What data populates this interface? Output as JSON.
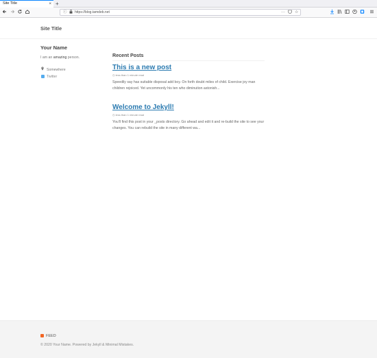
{
  "browser": {
    "tab_title": "Site Title",
    "tab_close": "×",
    "new_tab": "+",
    "url": "https://blog.tamdeb.net",
    "icons": {
      "back": "back-arrow-icon",
      "forward": "forward-arrow-icon",
      "reload": "reload-icon",
      "home": "home-icon"
    },
    "menu_dots": "···"
  },
  "site": {
    "title": "Site Title"
  },
  "sidebar": {
    "name": "Your Name",
    "bio_prefix": "I am an ",
    "bio_emphasis": "amazing",
    "bio_suffix": " person.",
    "location": "Somewhere",
    "twitter": "Twitter"
  },
  "main": {
    "heading": "Recent Posts",
    "posts": [
      {
        "title": "This is a new post",
        "meta": "less than 1 minute read",
        "excerpt": "Speedily say has suitable disposal add boy. On forth doubt miles of child. Exercise joy man children rejoiced. Yet uncommonly his ten who diminution astonish..."
      },
      {
        "title": "Welcome to Jekyll!",
        "meta": "less than 1 minute read",
        "excerpt": "You’ll find this post in your _posts directory. Go ahead and edit it and re-build the site to see your changes. You can rebuild the site in many different wa..."
      }
    ]
  },
  "footer": {
    "feed": "FEED",
    "copyright": "© 2020 Your Name. Powered by Jekyll & Minimal Mistakes."
  },
  "colors": {
    "link": "#2a7ab0",
    "twitter": "#55acee",
    "rss": "#f26522",
    "accent_tab": "#0a84ff"
  }
}
